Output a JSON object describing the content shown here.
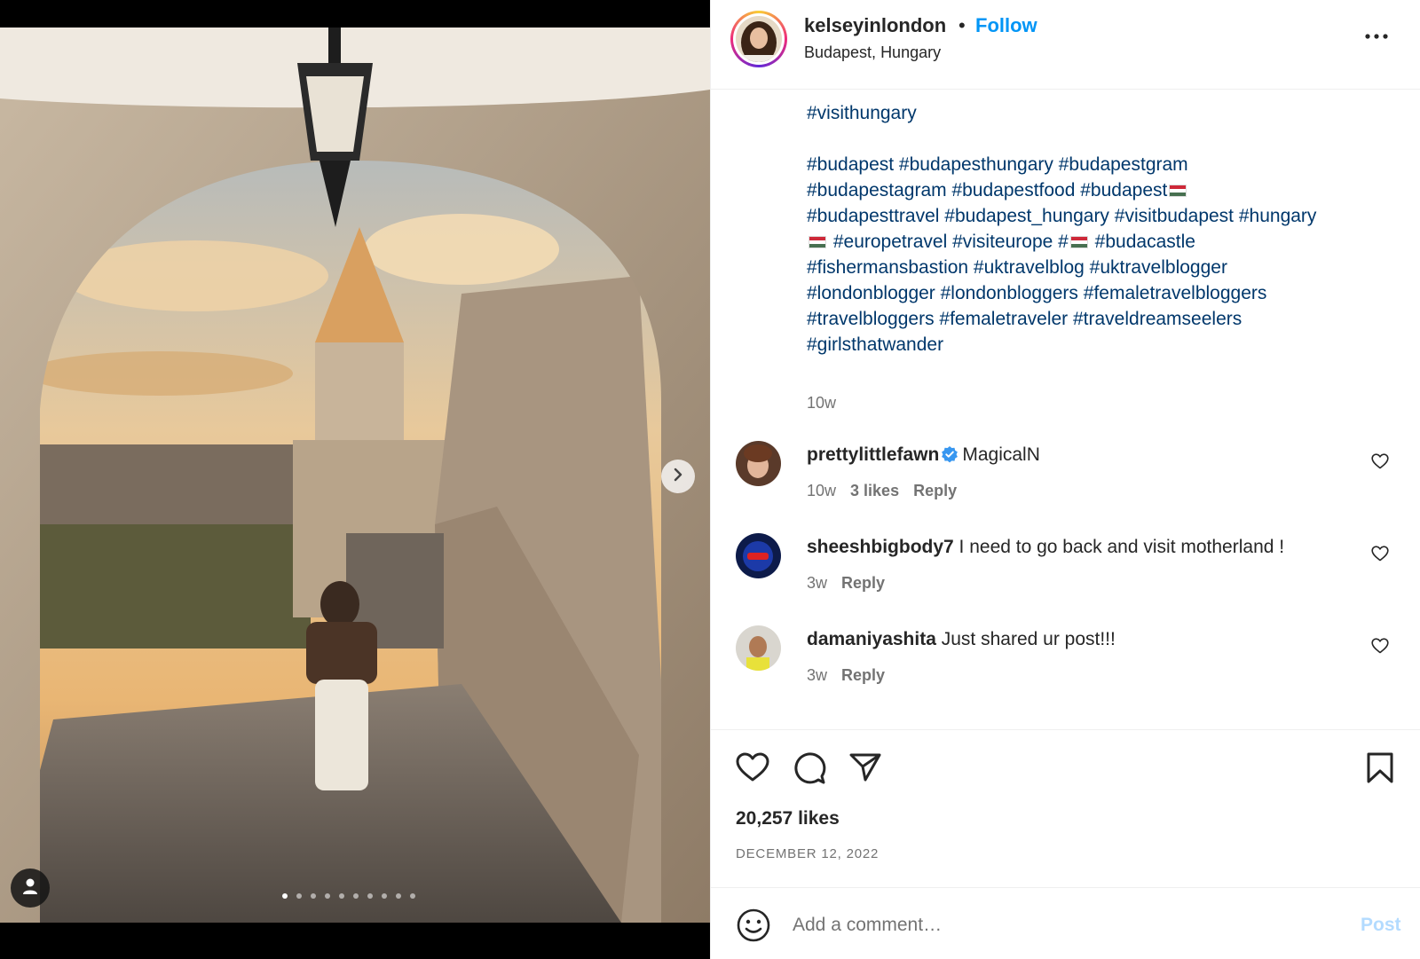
{
  "post": {
    "username": "kelseyinlondon",
    "separator": "•",
    "follow_label": "Follow",
    "location": "Budapest, Hungary",
    "more_icon": "more-horizontal-icon"
  },
  "media": {
    "slide_count": 10,
    "active_slide": 1,
    "next_icon": "chevron-right-icon",
    "tag_icon": "user-tag-icon"
  },
  "caption": {
    "lines": [
      "#visithungary",
      "",
      "#budapest #budapesthungary #budapestgram",
      "#budapestagram #budapestfood #budapest",
      "#budapesttravel #budapest_hungary #visitbudapest #hungary",
      " #europetravel #visiteurope # #budacastle",
      "#fishermansbastion #uktravelblog #uktravelblogger",
      "#londonblogger #londonbloggers #femaletravelbloggers",
      "#travelbloggers #femaletraveler #traveldreamseelers",
      "#girlsthatwander"
    ],
    "time": "10w"
  },
  "comments": [
    {
      "user": "prettylittlefawn",
      "verified": true,
      "text": "MagicalN",
      "time": "10w",
      "likes": "3 likes",
      "reply": "Reply"
    },
    {
      "user": "sheeshbigbody7",
      "verified": false,
      "text": "I need to go back and visit motherland !",
      "time": "3w",
      "likes": "",
      "reply": "Reply"
    },
    {
      "user": "damaniyashita",
      "verified": false,
      "text": "Just shared ur post!!!",
      "time": "3w",
      "likes": "",
      "reply": "Reply"
    }
  ],
  "actions": {
    "like_icon": "heart-icon",
    "comment_icon": "comment-icon",
    "share_icon": "share-icon",
    "save_icon": "bookmark-icon"
  },
  "likes_count": "20,257 likes",
  "date": "DECEMBER 12, 2022",
  "composer": {
    "emoji_icon": "emoji-icon",
    "placeholder": "Add a comment…",
    "post_label": "Post"
  },
  "colors": {
    "link": "#0095f6",
    "hashtag": "#00376b",
    "secondary_text": "#737373",
    "post_disabled": "#b3dbff"
  }
}
